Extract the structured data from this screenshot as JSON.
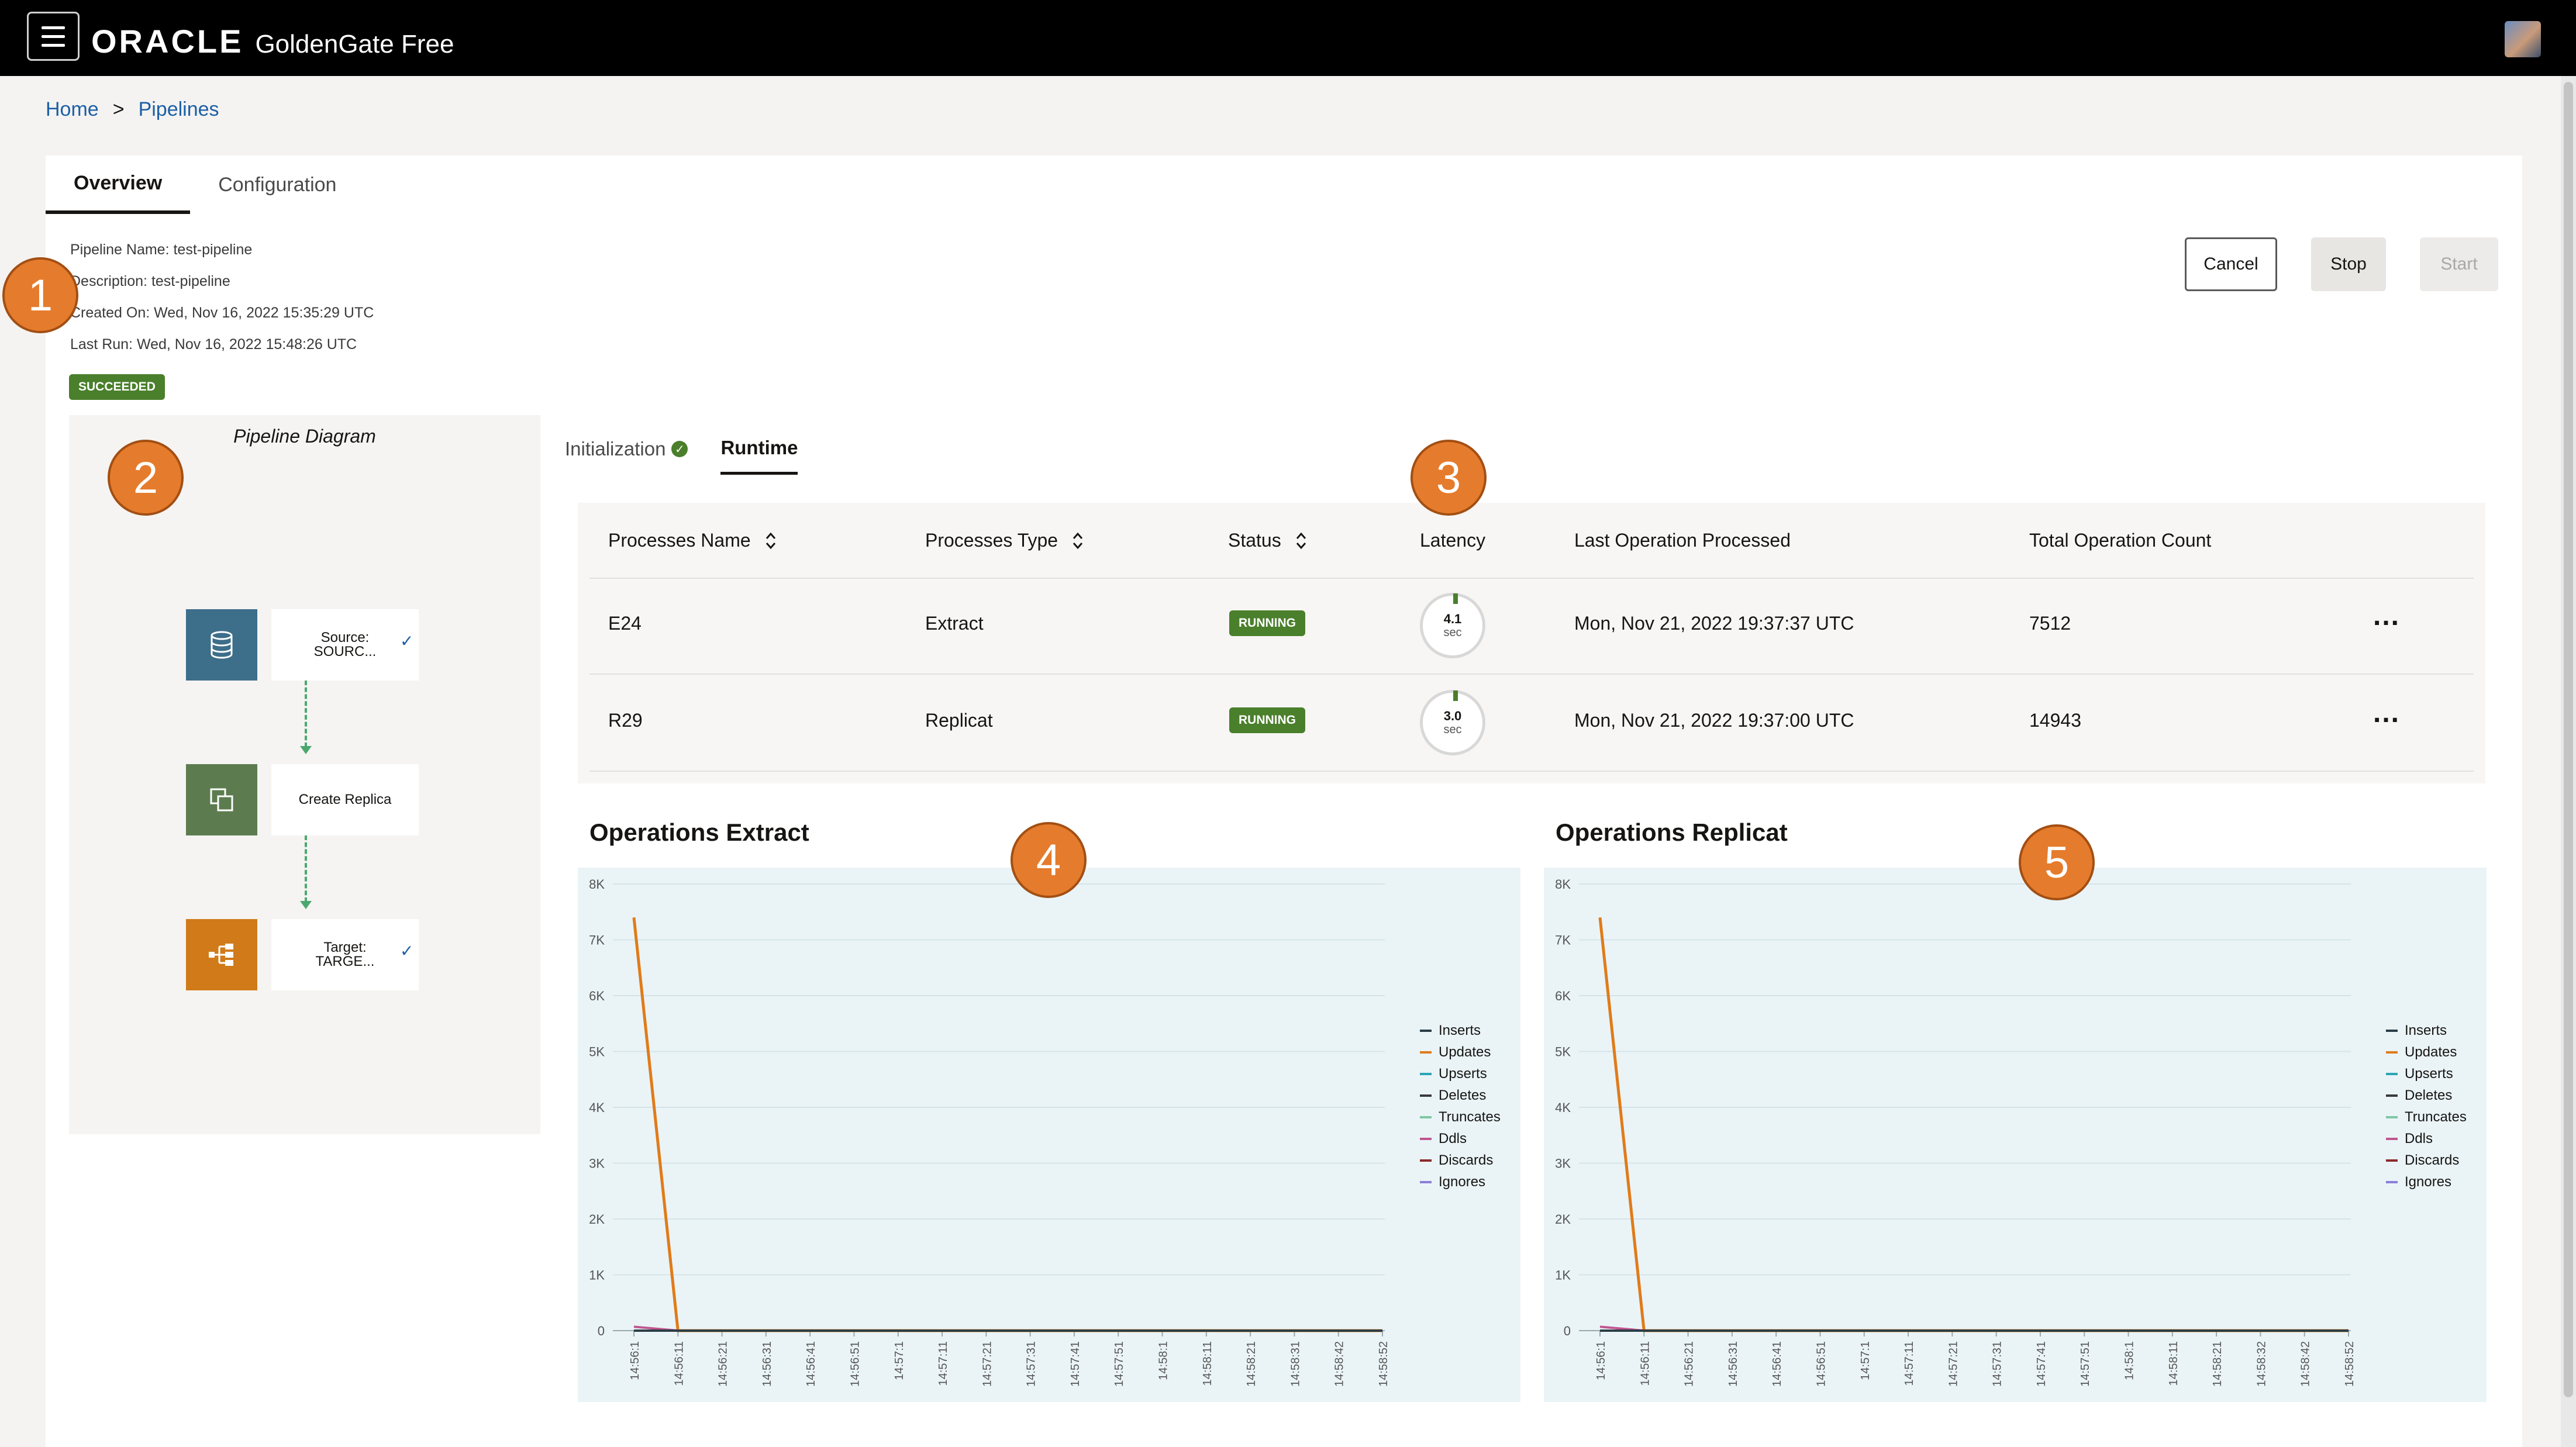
{
  "app": {
    "brand": "ORACLE",
    "product": "GoldenGate Free"
  },
  "breadcrumb": {
    "home": "Home",
    "separator": ">",
    "current": "Pipelines"
  },
  "tabs": [
    {
      "label": "Overview",
      "active": true
    },
    {
      "label": "Configuration",
      "active": false
    }
  ],
  "pipeline": {
    "name": "Pipeline Name: test-pipeline",
    "description": "Description: test-pipeline",
    "created": "Created On: Wed, Nov 16, 2022 15:35:29 UTC",
    "last_run": "Last Run: Wed, Nov 16, 2022 15:48:26 UTC",
    "status": "SUCCEEDED"
  },
  "actions": {
    "cancel": "Cancel",
    "stop": "Stop",
    "start": "Start"
  },
  "callouts": [
    "1",
    "2",
    "3",
    "4",
    "5"
  ],
  "diagram": {
    "title": "Pipeline Diagram",
    "nodes": [
      {
        "label": "Source:\nSOURC...",
        "icon": "database-icon",
        "color": "#3d6e8a",
        "checked": true
      },
      {
        "label": "Create Replica",
        "icon": "copy-icon",
        "color": "#5c7c4f",
        "checked": false
      },
      {
        "label": "Target:\nTARGE...",
        "icon": "hierarchy-icon",
        "color": "#d07a1a",
        "checked": true
      }
    ]
  },
  "subtabs": [
    {
      "label": "Initialization",
      "done": true
    },
    {
      "label": "Runtime",
      "active": true
    }
  ],
  "table": {
    "headers": [
      "Processes Name",
      "Processes Type",
      "Status",
      "Latency",
      "Last Operation Processed",
      "Total Operation Count"
    ],
    "rows": [
      {
        "name": "E24",
        "type": "Extract",
        "status": "RUNNING",
        "latency": "4.1",
        "latency_unit": "sec",
        "last_op": "Mon, Nov 21, 2022 19:37:37 UTC",
        "count": "7512"
      },
      {
        "name": "R29",
        "type": "Replicat",
        "status": "RUNNING",
        "latency": "3.0",
        "latency_unit": "sec",
        "last_op": "Mon, Nov 21, 2022 19:37:00 UTC",
        "count": "14943"
      }
    ],
    "more": "..."
  },
  "colors": {
    "running": "#4a7f2b",
    "inserts": "#2b3d47",
    "updates": "#e07b1a",
    "upserts": "#2ba5b5",
    "deletes": "#3a3a3a",
    "truncates": "#7fc7a3",
    "ddls": "#c0558f",
    "discards": "#8b2a2a",
    "ignores": "#8c7fd6"
  },
  "chart_data": [
    {
      "type": "line",
      "title": "Operations Extract",
      "ylim": [
        0,
        8000
      ],
      "yticks": [
        "0",
        "1K",
        "2K",
        "3K",
        "4K",
        "5K",
        "6K",
        "7K",
        "8K"
      ],
      "x": [
        "14:56:1",
        "14:56:11",
        "14:56:21",
        "14:56:31",
        "14:56:41",
        "14:56:51",
        "14:57:1",
        "14:57:11",
        "14:57:21",
        "14:57:31",
        "14:57:41",
        "14:57:51",
        "14:58:1",
        "14:58:11",
        "14:58:21",
        "14:58:31",
        "14:58:42",
        "14:58:52"
      ],
      "series": [
        {
          "name": "Inserts",
          "values": [
            0,
            0,
            0,
            0,
            0,
            0,
            0,
            0,
            0,
            0,
            0,
            0,
            0,
            0,
            0,
            0,
            0,
            0
          ]
        },
        {
          "name": "Updates",
          "values": [
            7400,
            0,
            0,
            0,
            0,
            0,
            0,
            0,
            0,
            0,
            0,
            0,
            0,
            0,
            0,
            0,
            0,
            0
          ]
        },
        {
          "name": "Upserts",
          "values": [
            0,
            0,
            0,
            0,
            0,
            0,
            0,
            0,
            0,
            0,
            0,
            0,
            0,
            0,
            0,
            0,
            0,
            0
          ]
        },
        {
          "name": "Deletes",
          "values": [
            0,
            0,
            0,
            0,
            0,
            0,
            0,
            0,
            0,
            0,
            0,
            0,
            0,
            0,
            0,
            0,
            0,
            0
          ]
        },
        {
          "name": "Truncates",
          "values": [
            0,
            0,
            0,
            0,
            0,
            0,
            0,
            0,
            0,
            0,
            0,
            0,
            0,
            0,
            0,
            0,
            0,
            0
          ]
        },
        {
          "name": "Ddls",
          "values": [
            70,
            0,
            0,
            0,
            0,
            0,
            0,
            0,
            0,
            0,
            0,
            0,
            0,
            0,
            0,
            0,
            0,
            0
          ]
        },
        {
          "name": "Discards",
          "values": [
            0,
            0,
            0,
            0,
            0,
            0,
            0,
            0,
            0,
            0,
            0,
            0,
            0,
            0,
            0,
            0,
            0,
            0
          ]
        },
        {
          "name": "Ignores",
          "values": [
            0,
            0,
            0,
            0,
            0,
            0,
            0,
            0,
            0,
            0,
            0,
            0,
            0,
            0,
            0,
            0,
            0,
            0
          ]
        }
      ]
    },
    {
      "type": "line",
      "title": "Operations Replicat",
      "ylim": [
        0,
        8000
      ],
      "yticks": [
        "0",
        "1K",
        "2K",
        "3K",
        "4K",
        "5K",
        "6K",
        "7K",
        "8K"
      ],
      "x": [
        "14:56:1",
        "14:56:11",
        "14:56:21",
        "14:56:31",
        "14:56:41",
        "14:56:51",
        "14:57:1",
        "14:57:11",
        "14:57:21",
        "14:57:31",
        "14:57:41",
        "14:57:51",
        "14:58:1",
        "14:58:11",
        "14:58:21",
        "14:58:32",
        "14:58:42",
        "14:58:52"
      ],
      "series": [
        {
          "name": "Inserts",
          "values": [
            0,
            0,
            0,
            0,
            0,
            0,
            0,
            0,
            0,
            0,
            0,
            0,
            0,
            0,
            0,
            0,
            0,
            0
          ]
        },
        {
          "name": "Updates",
          "values": [
            7400,
            0,
            0,
            0,
            0,
            0,
            0,
            0,
            0,
            0,
            0,
            0,
            0,
            0,
            0,
            0,
            0,
            0
          ]
        },
        {
          "name": "Upserts",
          "values": [
            0,
            0,
            0,
            0,
            0,
            0,
            0,
            0,
            0,
            0,
            0,
            0,
            0,
            0,
            0,
            0,
            0,
            0
          ]
        },
        {
          "name": "Deletes",
          "values": [
            0,
            0,
            0,
            0,
            0,
            0,
            0,
            0,
            0,
            0,
            0,
            0,
            0,
            0,
            0,
            0,
            0,
            0
          ]
        },
        {
          "name": "Truncates",
          "values": [
            0,
            0,
            0,
            0,
            0,
            0,
            0,
            0,
            0,
            0,
            0,
            0,
            0,
            0,
            0,
            0,
            0,
            0
          ]
        },
        {
          "name": "Ddls",
          "values": [
            70,
            0,
            0,
            0,
            0,
            0,
            0,
            0,
            0,
            0,
            0,
            0,
            0,
            0,
            0,
            0,
            0,
            0
          ]
        },
        {
          "name": "Discards",
          "values": [
            0,
            0,
            0,
            0,
            0,
            0,
            0,
            0,
            0,
            0,
            0,
            0,
            0,
            0,
            0,
            0,
            0,
            0
          ]
        },
        {
          "name": "Ignores",
          "values": [
            0,
            0,
            0,
            0,
            0,
            0,
            0,
            0,
            0,
            0,
            0,
            0,
            0,
            0,
            0,
            0,
            0,
            0
          ]
        }
      ]
    }
  ]
}
